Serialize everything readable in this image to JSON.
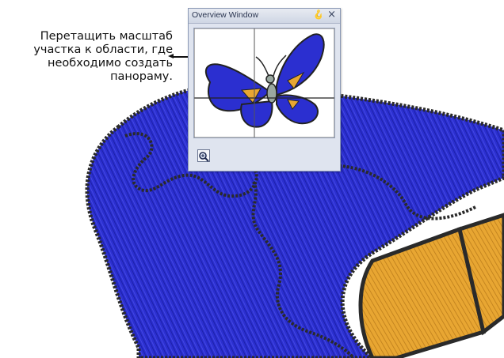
{
  "overview_window": {
    "title": "Overview Window",
    "pin_icon": "pin-icon",
    "close_icon": "close-icon",
    "zoom_icon": "zoom-icon"
  },
  "callout": {
    "text": "Перетащить масштаб участка к области, где необходимо создать панораму."
  },
  "colors": {
    "embroidery_blue": "#2b2fd0",
    "embroidery_gold": "#e8a632",
    "outline": "#2a2a2a"
  }
}
